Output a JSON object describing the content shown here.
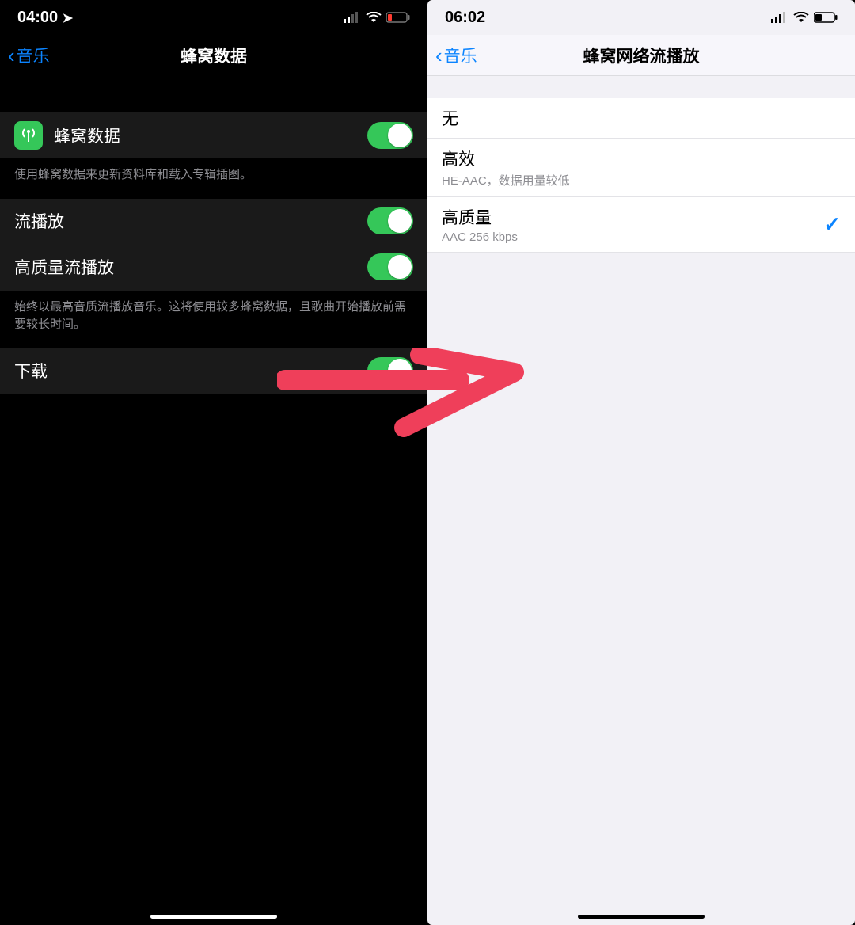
{
  "left": {
    "status": {
      "time": "04:00"
    },
    "nav": {
      "back": "音乐",
      "title": "蜂窝数据"
    },
    "rows": {
      "cellular": {
        "label": "蜂窝数据",
        "footer": "使用蜂窝数据来更新资料库和载入专辑插图。"
      },
      "streaming": {
        "label": "流播放"
      },
      "hq_streaming": {
        "label": "高质量流播放",
        "footer": "始终以最高音质流播放音乐。这将使用较多蜂窝数据，且歌曲开始播放前需要较长时间。"
      },
      "download": {
        "label": "下载"
      }
    }
  },
  "right": {
    "status": {
      "time": "06:02"
    },
    "nav": {
      "back": "音乐",
      "title": "蜂窝网络流播放"
    },
    "options": {
      "none": {
        "title": "无"
      },
      "efficient": {
        "title": "高效",
        "sub": "HE-AAC，数据用量较低"
      },
      "hq": {
        "title": "高质量",
        "sub": "AAC 256 kbps"
      }
    }
  }
}
